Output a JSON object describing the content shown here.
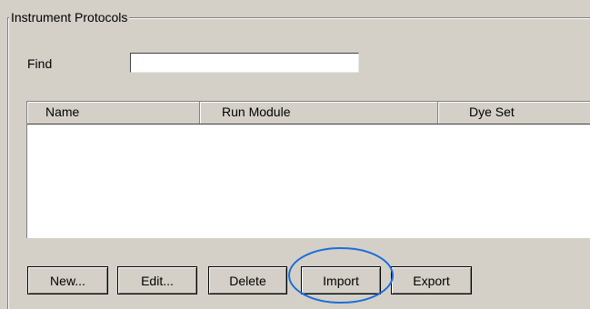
{
  "group": {
    "title": "Instrument Protocols"
  },
  "find": {
    "label": "Find",
    "value": "",
    "placeholder": ""
  },
  "table": {
    "columns": [
      "Name",
      "Run Module",
      "Dye Set"
    ],
    "rows": []
  },
  "buttons": {
    "new_label": "New...",
    "edit_label": "Edit...",
    "delete_label": "Delete",
    "import_label": "Import",
    "export_label": "Export"
  },
  "annotation": {
    "highlight_color": "#1a6ed8",
    "highlight_target": "Import"
  }
}
